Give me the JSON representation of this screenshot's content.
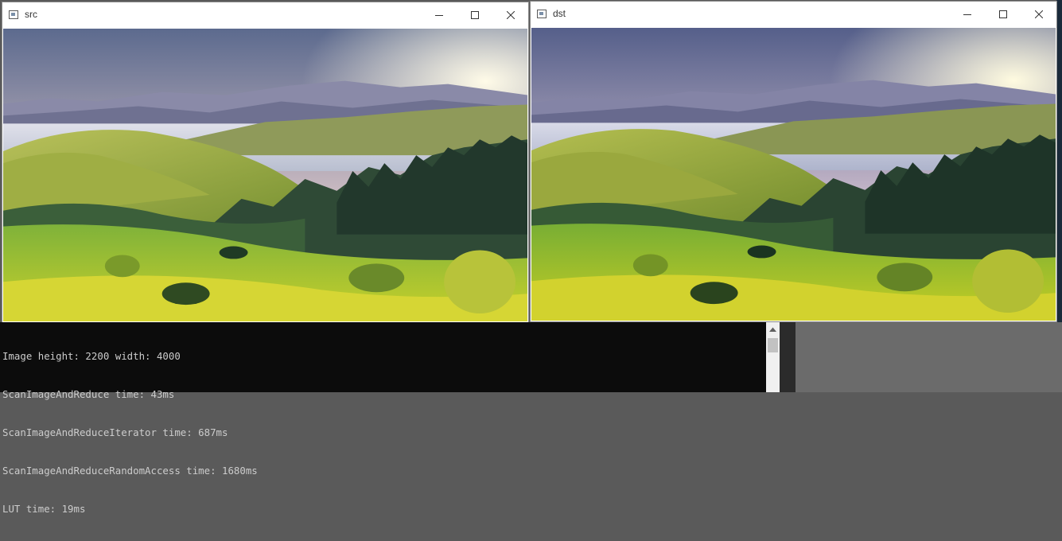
{
  "windows": {
    "src": {
      "title": "src"
    },
    "dst": {
      "title": "dst"
    }
  },
  "icons": {
    "app": "opencv-window-icon",
    "minimize": "minimize-icon",
    "maximize": "maximize-icon",
    "close": "close-icon",
    "scroll_up": "scroll-up-arrow-icon"
  },
  "console": {
    "lines": [
      "Image height: 2200 width: 4000",
      "ScanImageAndReduce time: 43ms",
      "ScanImageAndReduceIterator time: 687ms",
      "ScanImageAndReduceRandomAccess time: 1680ms",
      "LUT time: 19ms"
    ]
  },
  "colors": {
    "console_bg": "#0c0c0c",
    "console_text": "#cccccc",
    "titlebar_bg": "#ffffff"
  }
}
